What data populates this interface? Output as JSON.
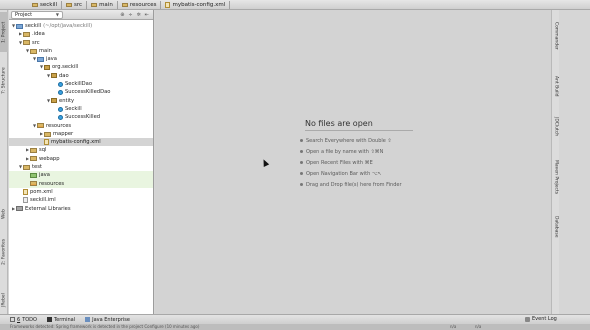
{
  "breadcrumb": {
    "items": [
      {
        "label": "seckill",
        "icon": "folder-icon"
      },
      {
        "label": "src",
        "icon": "folder-icon"
      },
      {
        "label": "main",
        "icon": "folder-icon"
      },
      {
        "label": "resources",
        "icon": "folder-icon"
      },
      {
        "label": "mybatis-config.xml",
        "icon": "xml-file-icon"
      }
    ]
  },
  "left_tabs": {
    "project": "1: Project",
    "structure": "7: Structure",
    "web": "Web",
    "favorites": "2: Favorites",
    "jrebel": "JRebel"
  },
  "right_tabs": {
    "commander": "Commander",
    "ant_build": "Ant Build",
    "jdclutch": "JDClutch",
    "maven": "Maven Projects",
    "database": "Database"
  },
  "project_panel": {
    "view_selector": "Project",
    "tree": [
      {
        "label": "seckill",
        "suffix": "(~/opt/java/seckill)"
      },
      {
        "label": ".idea"
      },
      {
        "label": "src"
      },
      {
        "label": "main"
      },
      {
        "label": "java"
      },
      {
        "label": "org.seckill"
      },
      {
        "label": "dao"
      },
      {
        "label": "SeckillDao"
      },
      {
        "label": "SuccessKilledDao"
      },
      {
        "label": "entity"
      },
      {
        "label": "Seckill"
      },
      {
        "label": "SuccessKilled"
      },
      {
        "label": "resources"
      },
      {
        "label": "mapper"
      },
      {
        "label": "mybatis-config.xml"
      },
      {
        "label": "sql"
      },
      {
        "label": "webapp"
      },
      {
        "label": "test"
      },
      {
        "label": "java"
      },
      {
        "label": "resources"
      },
      {
        "label": "pom.xml"
      },
      {
        "label": "seckill.iml"
      },
      {
        "label": "External Libraries"
      }
    ]
  },
  "editor": {
    "empty_title": "No files are open",
    "hints": [
      "Search Everywhere with Double ⇧",
      "Open a file by name with ⇧⌘N",
      "Open Recent Files with ⌘E",
      "Open Navigation Bar with ⌥↖",
      "Drag and Drop file(s) here from Finder"
    ]
  },
  "bottom_bar": {
    "todo_num": "6",
    "todo": "TODO",
    "terminal": "Terminal",
    "java_enterprise": "Java Enterprise",
    "event_log": "Event Log"
  },
  "status_bar": {
    "message": "Frameworks detected: Spring framework is detected in the project Configure (10 minutes ago)",
    "position": "n/a",
    "encoding": "n/a"
  }
}
